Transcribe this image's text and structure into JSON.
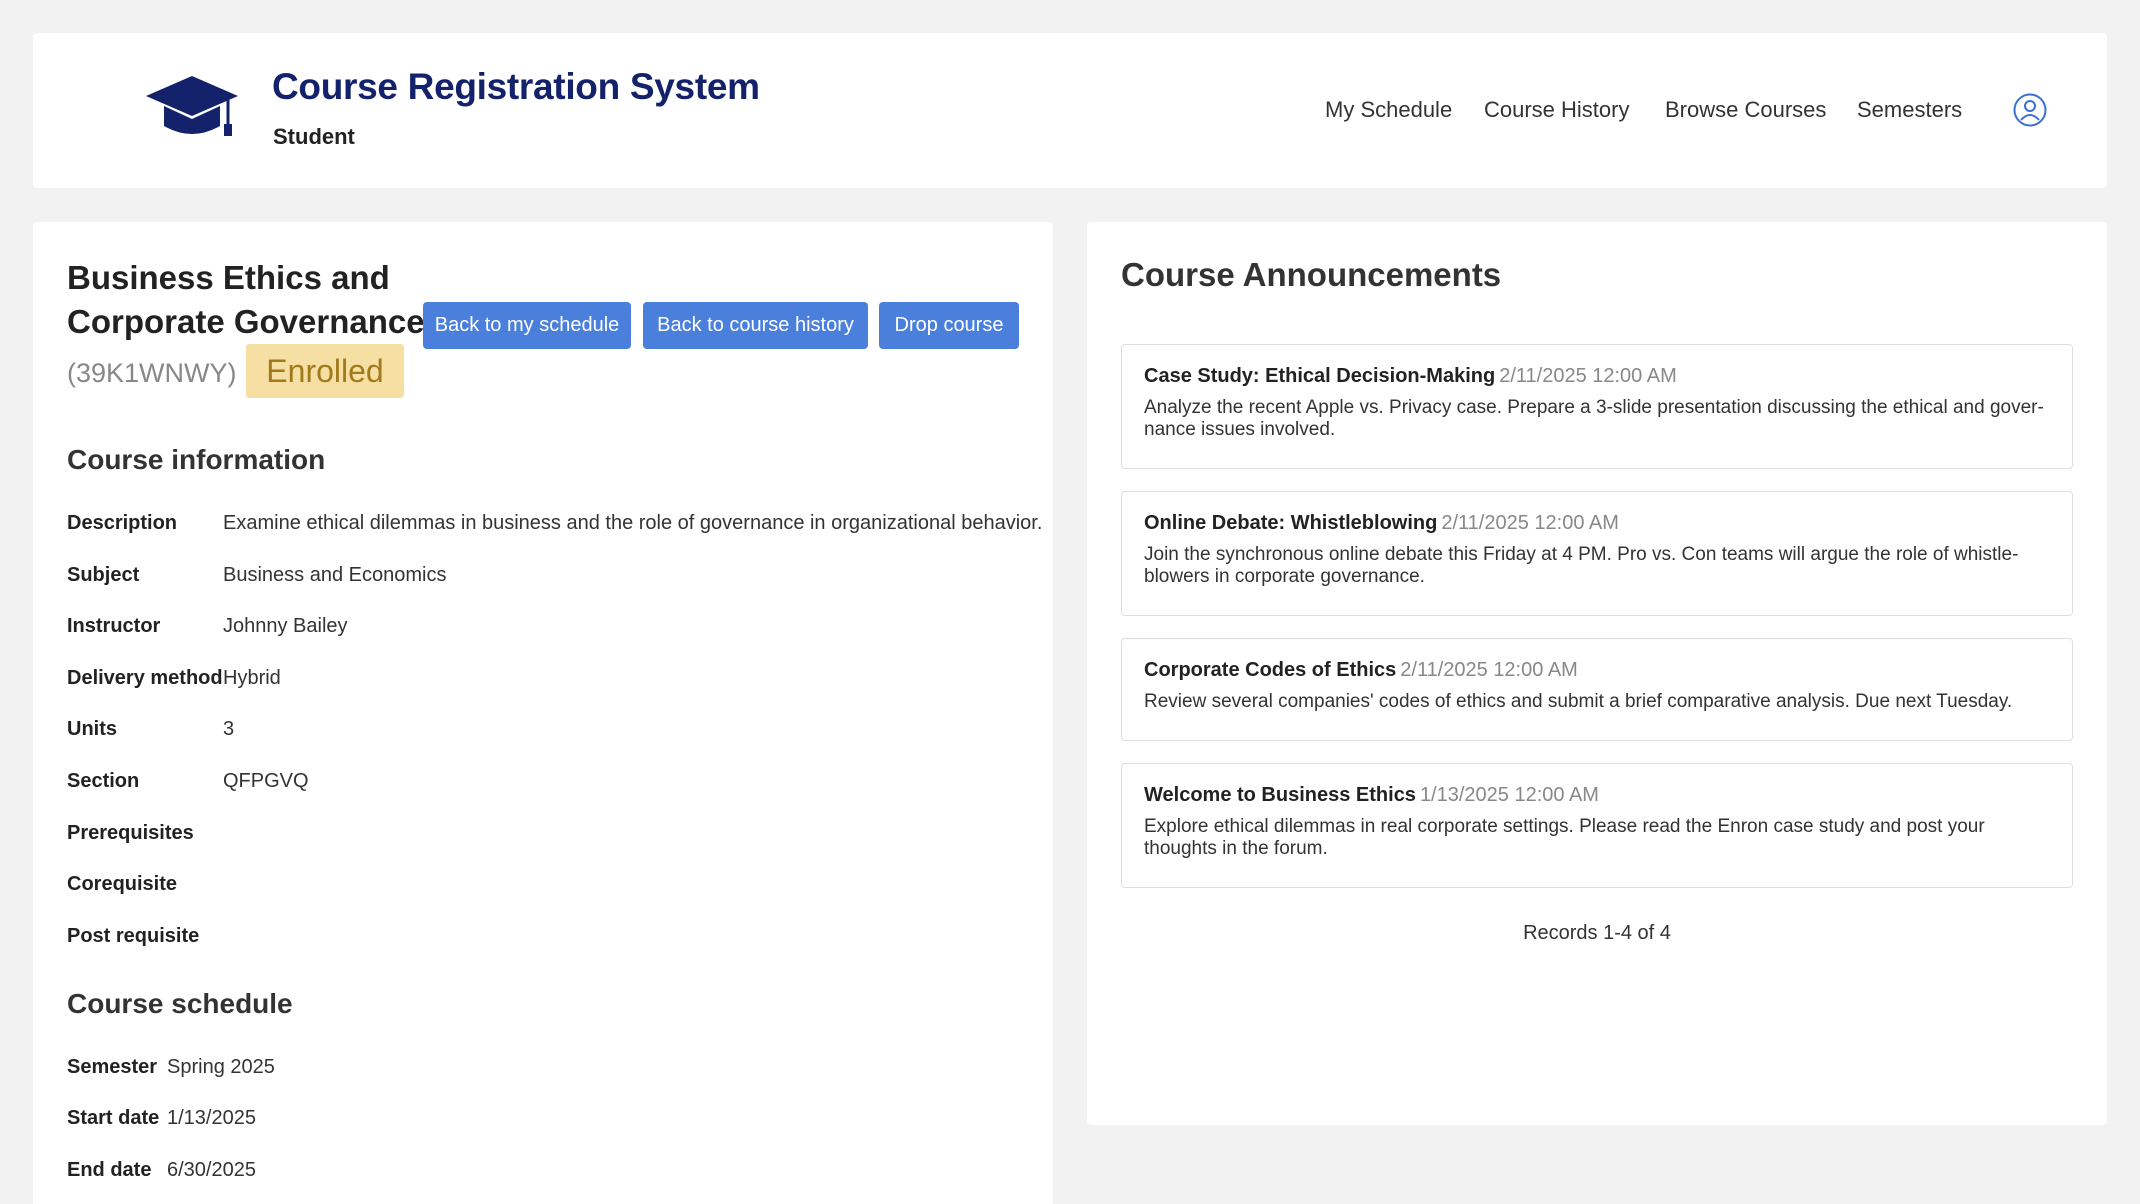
{
  "header": {
    "app_title": "Course Registration System",
    "role": "Student",
    "nav": [
      "My Schedule",
      "Course History",
      "Browse Courses",
      "Semesters"
    ]
  },
  "course": {
    "title": "Business Ethics and Corporate Governance",
    "code": "(39K1WNWY)",
    "status": "Enrolled",
    "buttons": {
      "back_schedule": "Back to my schedule",
      "back_history": "Back to course history",
      "drop": "Drop course"
    },
    "info_heading": "Course information",
    "info": [
      {
        "label": "Description",
        "value": "Examine ethical dilemmas in business and the role of governance in organizational behavior."
      },
      {
        "label": "Subject",
        "value": "Business and Economics"
      },
      {
        "label": "Instructor",
        "value": "Johnny Bailey"
      },
      {
        "label": "Delivery method",
        "value": "Hybrid"
      },
      {
        "label": "Units",
        "value": "3"
      },
      {
        "label": "Section",
        "value": "QFPGVQ"
      },
      {
        "label": "Prerequisites",
        "value": ""
      },
      {
        "label": "Corequisite",
        "value": ""
      },
      {
        "label": "Post requisite",
        "value": ""
      }
    ],
    "schedule_heading": "Course schedule",
    "schedule": [
      {
        "label": "Semester",
        "value": "Spring 2025"
      },
      {
        "label": "Start date",
        "value": "1/13/2025"
      },
      {
        "label": "End date",
        "value": "6/30/2025"
      }
    ]
  },
  "announcements": {
    "heading": "Course Announcements",
    "items": [
      {
        "title": "Case Study: Ethical Decision-Making",
        "date": "2/11/2025 12:00 AM",
        "body": [
          "Analyze the recent Apple vs. Privacy case. Prepare a 3-slide presentation discussing the ethical and gover-",
          "nance issues involved."
        ]
      },
      {
        "title": "Online Debate: Whistleblowing",
        "date": "2/11/2025 12:00 AM",
        "body": [
          "Join the synchronous online debate this Friday at 4 PM. Pro vs. Con teams will argue the role of whistle-",
          "blowers in corporate governance."
        ]
      },
      {
        "title": "Corporate Codes of Ethics",
        "date": "2/11/2025 12:00 AM",
        "body": [
          "Review several companies' codes of ethics and submit a brief comparative analysis. Due next Tuesday."
        ]
      },
      {
        "title": "Welcome to Business Ethics",
        "date": "1/13/2025 12:00 AM",
        "body": [
          "Explore ethical dilemmas in real corporate settings. Please read the Enron case study and post your",
          "thoughts in the forum."
        ]
      }
    ],
    "records": "Records 1-4 of 4"
  },
  "colors": {
    "brand": "#13226b",
    "button": "#4a7fdc",
    "badge_bg": "#f5dfa3",
    "badge_text": "#a27a1b",
    "user_icon": "#3b6fd4"
  }
}
